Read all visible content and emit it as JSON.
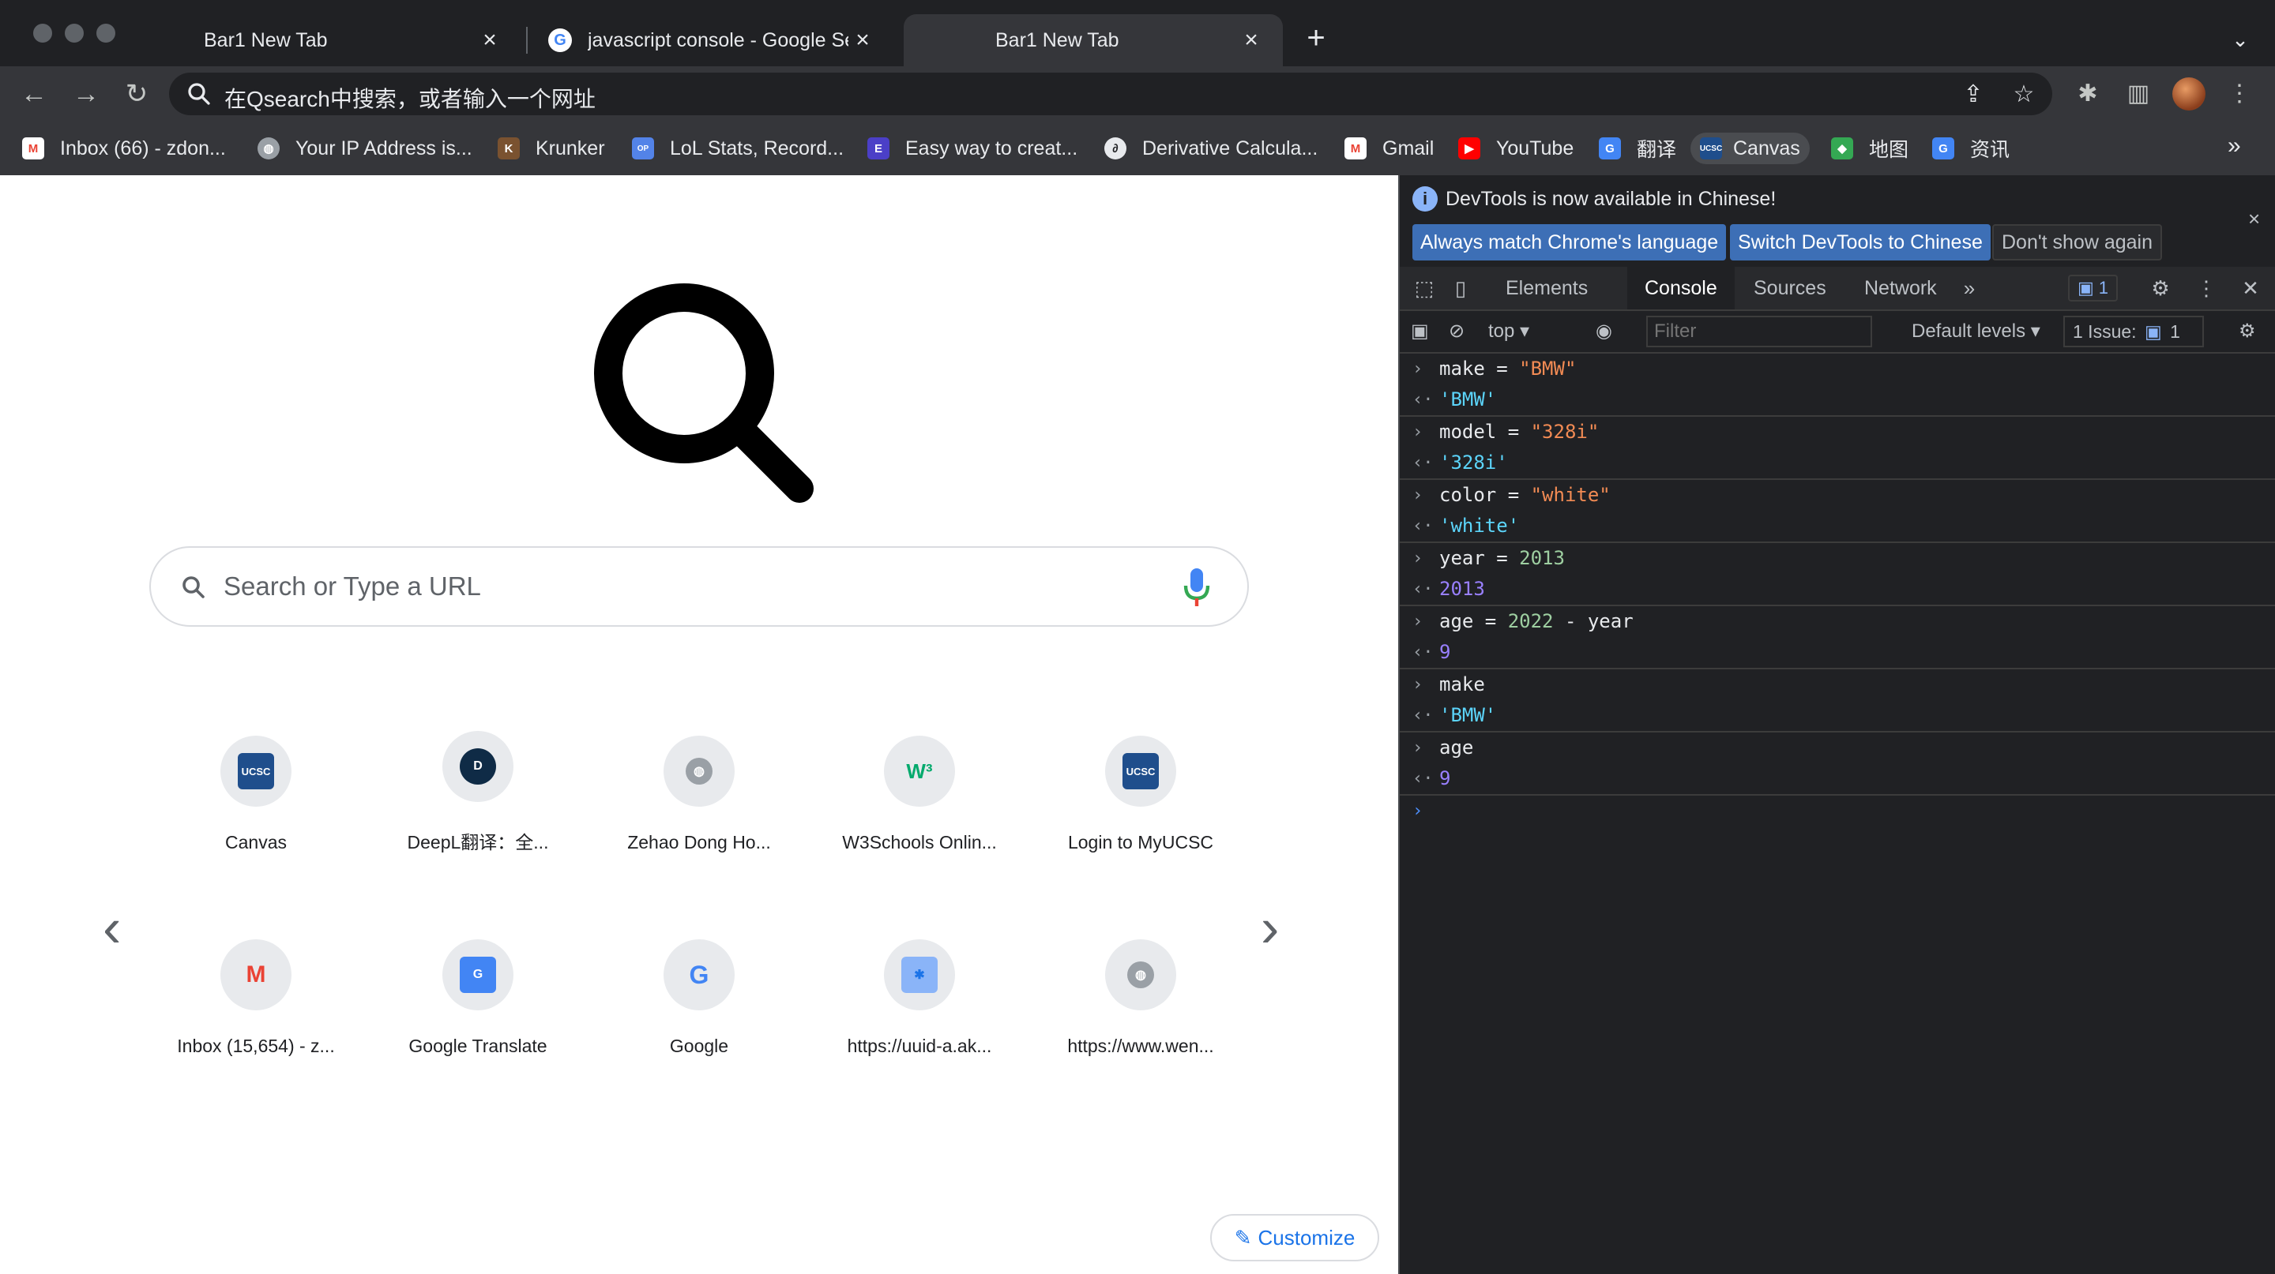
{
  "tabs": [
    {
      "title": "Bar1 New Tab",
      "active": false
    },
    {
      "title": "javascript console - Google Se",
      "active": false
    },
    {
      "title": "Bar1 New Tab",
      "active": true
    }
  ],
  "omnibox": {
    "placeholder": "在Qsearch中搜索，或者输入一个网址"
  },
  "bookmarks": [
    {
      "label": "Inbox (66) - zdon...",
      "icon": "gmail-icon"
    },
    {
      "label": "Your IP Address is...",
      "icon": "globe-icon"
    },
    {
      "label": "Krunker",
      "icon": "krunker-icon"
    },
    {
      "label": "LoL Stats, Record...",
      "icon": "opgg-icon"
    },
    {
      "label": "Easy way to creat...",
      "icon": "easy-icon"
    },
    {
      "label": "Derivative Calcula...",
      "icon": "derivative-icon"
    },
    {
      "label": "Gmail",
      "icon": "gmail-icon"
    },
    {
      "label": "YouTube",
      "icon": "youtube-icon"
    },
    {
      "label": "翻译",
      "icon": "translate-icon"
    },
    {
      "label": "Canvas",
      "icon": "ucsc-icon"
    },
    {
      "label": "地图",
      "icon": "maps-icon"
    },
    {
      "label": "资讯",
      "icon": "news-icon"
    }
  ],
  "ntp": {
    "search_placeholder": "Search or Type a URL",
    "tiles_row1": [
      "Canvas",
      "DeepL翻译：全...",
      "Zehao Dong Ho...",
      "W3Schools Onlin...",
      "Login to MyUCSC"
    ],
    "tiles_row2": [
      "Inbox (15,654) - z...",
      "Google Translate",
      "Google",
      "https://uuid-a.ak...",
      "https://www.wen..."
    ],
    "customize_label": "Customize"
  },
  "devtools": {
    "info_message": "DevTools is now available in Chinese!",
    "btn_always_match": "Always match Chrome's language",
    "btn_switch": "Switch DevTools to Chinese",
    "btn_dont_show": "Don't show again",
    "tabs": [
      "Elements",
      "Console",
      "Sources",
      "Network"
    ],
    "active_tab": "Console",
    "issues_count": "1",
    "context": "top",
    "filter_placeholder": "Filter",
    "levels": "Default levels",
    "issue_label": "1 Issue:",
    "issue_count": "1"
  },
  "console": [
    {
      "input_parts": [
        "make = ",
        "\"BMW\""
      ],
      "output": "'BMW'",
      "out_type": "str"
    },
    {
      "input_parts": [
        "model = ",
        "\"328i\""
      ],
      "output": "'328i'",
      "out_type": "str"
    },
    {
      "input_parts": [
        "color = ",
        "\"white\""
      ],
      "output": "'white'",
      "out_type": "str"
    },
    {
      "input_parts": [
        "year = ",
        "2013"
      ],
      "output": "2013",
      "out_type": "num"
    },
    {
      "input_parts": [
        "age = ",
        "2022",
        " - year"
      ],
      "output": "9",
      "out_type": "num"
    },
    {
      "input_parts": [
        "make"
      ],
      "output": "'BMW'",
      "out_type": "str"
    },
    {
      "input_parts": [
        "age"
      ],
      "output": "9",
      "out_type": "num"
    }
  ]
}
